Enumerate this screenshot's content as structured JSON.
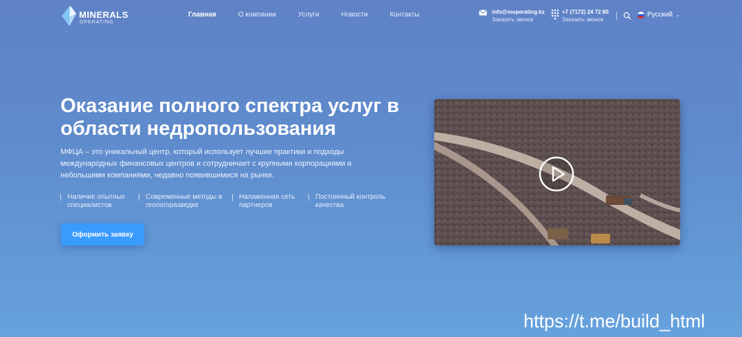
{
  "header": {
    "logo": {
      "name": "MINERALS",
      "sub": "OPERATING"
    },
    "nav": [
      {
        "label": "Главная",
        "active": true
      },
      {
        "label": "О компании",
        "active": false
      },
      {
        "label": "Услуги",
        "active": false
      },
      {
        "label": "Новости",
        "active": false
      },
      {
        "label": "Контакты",
        "active": false
      }
    ],
    "contacts": {
      "email": {
        "value": "info@moperating.kz",
        "action": "Заказать звонок",
        "icon": "mail-icon"
      },
      "phone": {
        "value": "+7 (7172) 24 72 80",
        "action": "Заказать звонок",
        "icon": "dialpad-icon"
      }
    },
    "search_icon": "search-icon",
    "language": {
      "label": "Русский",
      "icon": "flag-ru-icon"
    }
  },
  "hero": {
    "title": "Оказание полного спектра услуг в области недропользования",
    "description": "МФЦА – это уникальный центр, который использует лучшие практики и подходы международных финансовых центров и сотрудничает с крупными корпорациями и небольшими компаниями, недавно появившимися на рынке.",
    "features": [
      "Наличие опытных специалистов",
      "Современные методы в геологоразведке",
      "Налаженная сеть партнеров",
      "Постоянный контроль качества"
    ],
    "cta_label": "Оформить заявку",
    "video": {
      "play_icon": "play-icon"
    }
  },
  "watermark": "https://t.me/build_html",
  "colors": {
    "background_top": "#5f82c6",
    "background_bottom": "#66a2dd",
    "cta": "#3a9bff",
    "text": "#ffffff"
  }
}
